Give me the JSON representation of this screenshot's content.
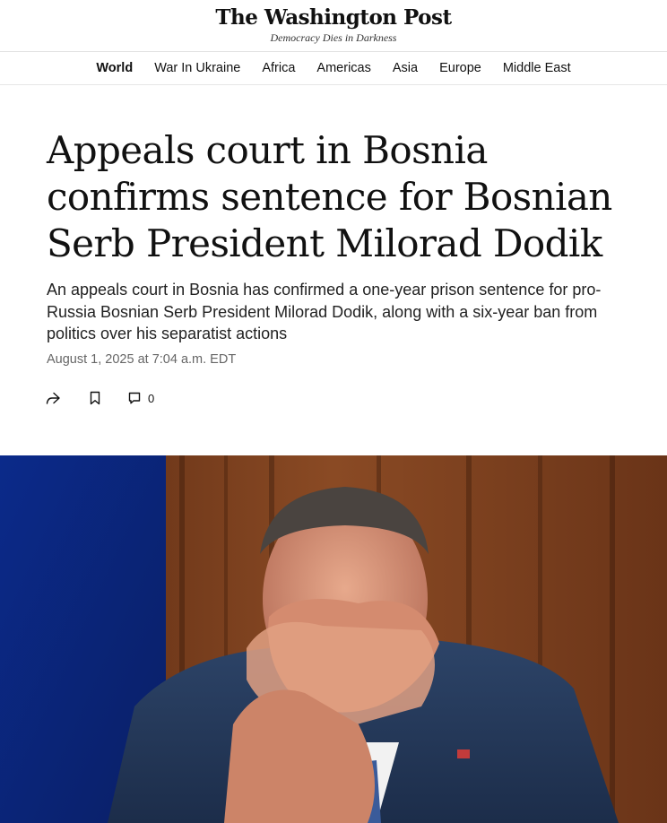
{
  "masthead": {
    "logo": "The Washington Post",
    "tagline": "Democracy Dies in Darkness"
  },
  "nav": {
    "items": [
      {
        "label": "World",
        "active": true
      },
      {
        "label": "War In Ukraine"
      },
      {
        "label": "Africa"
      },
      {
        "label": "Americas"
      },
      {
        "label": "Asia"
      },
      {
        "label": "Europe"
      },
      {
        "label": "Middle East"
      }
    ]
  },
  "article": {
    "headline": "Appeals court in Bosnia confirms sentence for Bosnian Serb President Milorad Dodik",
    "dek": "An appeals court in Bosnia has confirmed a one-year prison sentence for pro-Russia Bosnian Serb President Milorad Dodik, along with a six-year ban from politics over his separatist actions",
    "timestamp": "August 1, 2025 at 7:04 a.m. EDT"
  },
  "actions": {
    "share_icon": "share-icon",
    "save_icon": "bookmark-icon",
    "comment_icon": "comment-icon",
    "comment_count": "0"
  },
  "colors": {
    "text": "#111111",
    "meta": "#666666",
    "rule": "#e2e2e2"
  }
}
